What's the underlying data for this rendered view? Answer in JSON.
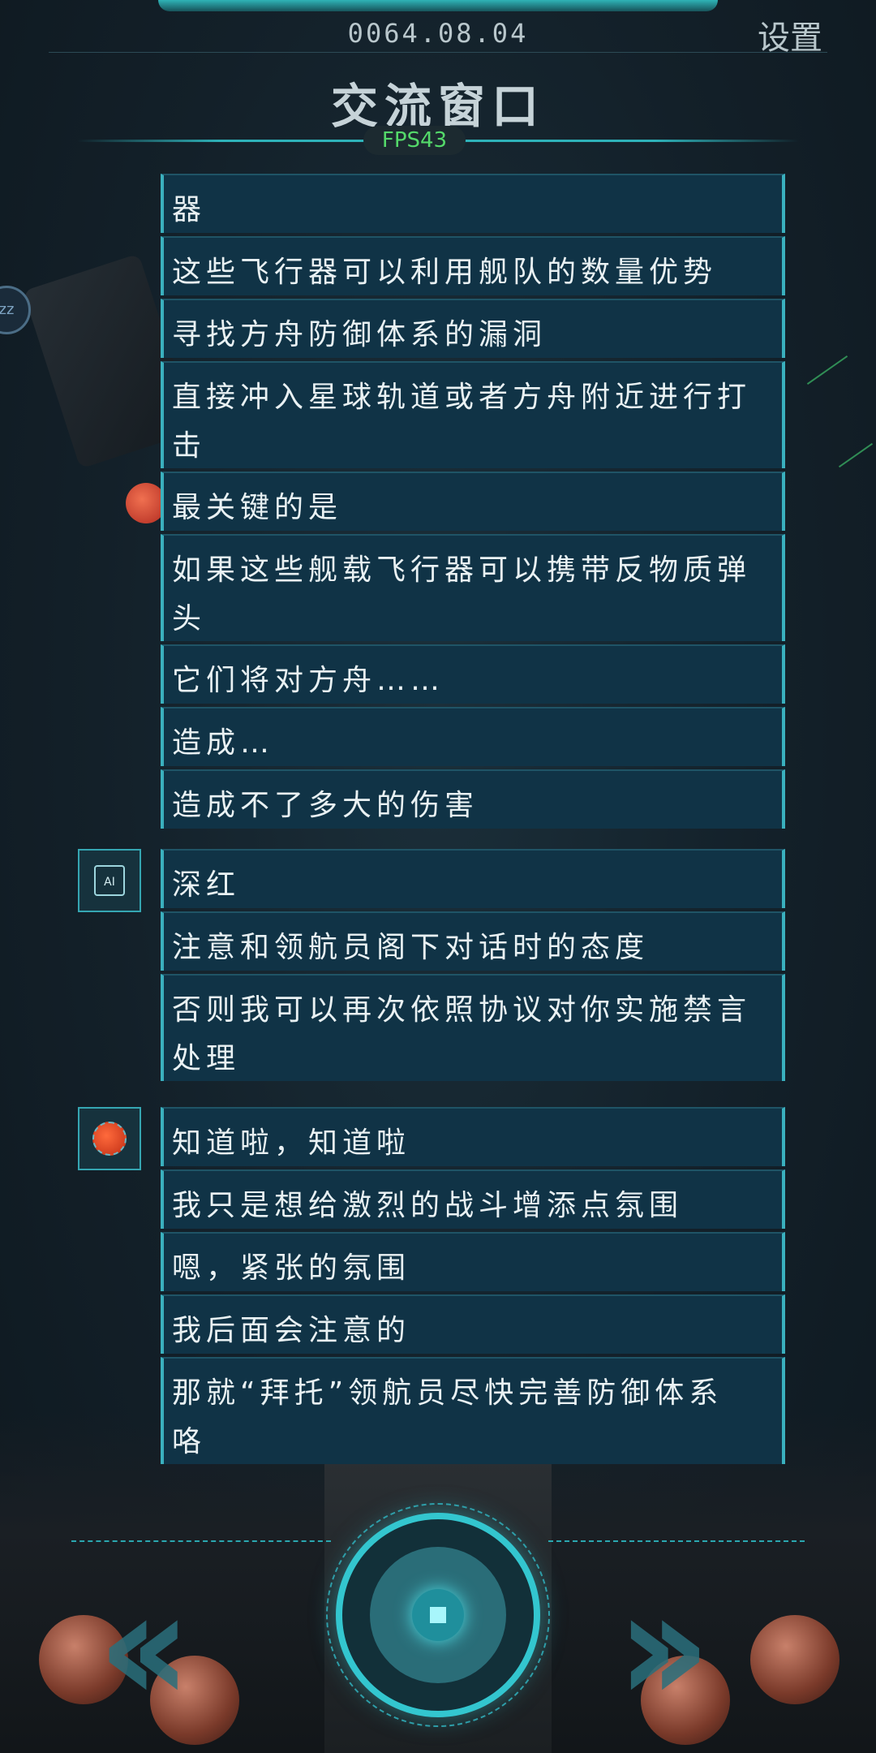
{
  "header": {
    "date": "0064.08.04",
    "settings_label": "设置",
    "title": "交流窗口",
    "fps": "FPS43"
  },
  "side_badge": "zz",
  "messages_top": [
    [
      "器"
    ],
    [
      "这些飞行器可以利用舰队的数量优势"
    ],
    [
      "寻找方舟防御体系的漏洞"
    ],
    [
      "直接冲入星球轨道或者方舟附近进行打",
      "击"
    ],
    [
      "最关键的是"
    ],
    [
      "如果这些舰载飞行器可以携带反物质弹",
      "头"
    ],
    [
      "它们将对方舟……"
    ],
    [
      "造成…"
    ],
    [
      "造成不了多大的伤害"
    ]
  ],
  "ai_avatar_label": "AI",
  "messages_ai": [
    [
      "深红"
    ],
    [
      "注意和领航员阁下对话时的态度"
    ],
    [
      "否则我可以再次依照协议对你实施禁言",
      "处理"
    ]
  ],
  "messages_red": [
    [
      "知道啦，知道啦"
    ],
    [
      "我只是想给激烈的战斗增添点氛围"
    ],
    [
      "嗯，紧张的氛围"
    ],
    [
      "我后面会注意的"
    ],
    [
      "那就“拜托”领航员尽快完善防御体系",
      "咯"
    ]
  ],
  "controls": {
    "prev_icon": "double-chevron-left-icon",
    "next_icon": "double-chevron-right-icon",
    "center_icon": "stop-square-icon"
  },
  "colors": {
    "accent": "#33c6cf",
    "bubble": "#103346",
    "fps_green": "#54d96a"
  }
}
